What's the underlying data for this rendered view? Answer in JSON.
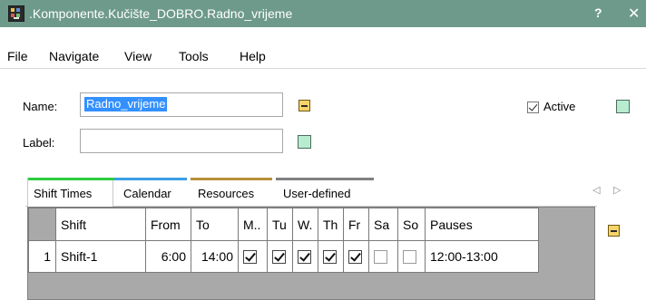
{
  "window": {
    "title": ".Komponente.Kučište_DOBRO.Radno_vrijeme",
    "help_label": "?",
    "close_label": "✕"
  },
  "menu": [
    "File",
    "Navigate",
    "View",
    "Tools",
    "Help"
  ],
  "form": {
    "name_label": "Name:",
    "name_value": "Radno_vrijeme",
    "label_label": "Label:",
    "label_value": "",
    "active_label": "Active",
    "active_checked": true
  },
  "tabs": [
    {
      "label": "Shift Times",
      "color": "#2ecc40",
      "active": true
    },
    {
      "label": "Calendar",
      "color": "#3c9ee5",
      "active": false
    },
    {
      "label": "Resources",
      "color": "#b8903a",
      "active": false
    },
    {
      "label": "User-defined",
      "color": "#808080",
      "active": false
    }
  ],
  "tab_nav": {
    "prev": "◁",
    "next": "▷"
  },
  "grid": {
    "columns": [
      "Shift",
      "From",
      "To",
      "M..",
      "Tu",
      "W.",
      "Th",
      "Fr",
      "Sa",
      "So",
      "Pauses"
    ],
    "rows": [
      {
        "index": "1",
        "shift": "Shift-1",
        "from": "6:00",
        "to": "14:00",
        "days": [
          true,
          true,
          true,
          true,
          true,
          false,
          false
        ],
        "pauses": "12:00-13:00"
      }
    ]
  },
  "colors": {
    "titlebar": "#6e9a8c",
    "selection": "#3390ff",
    "grid_background": "#a9a9a9"
  }
}
